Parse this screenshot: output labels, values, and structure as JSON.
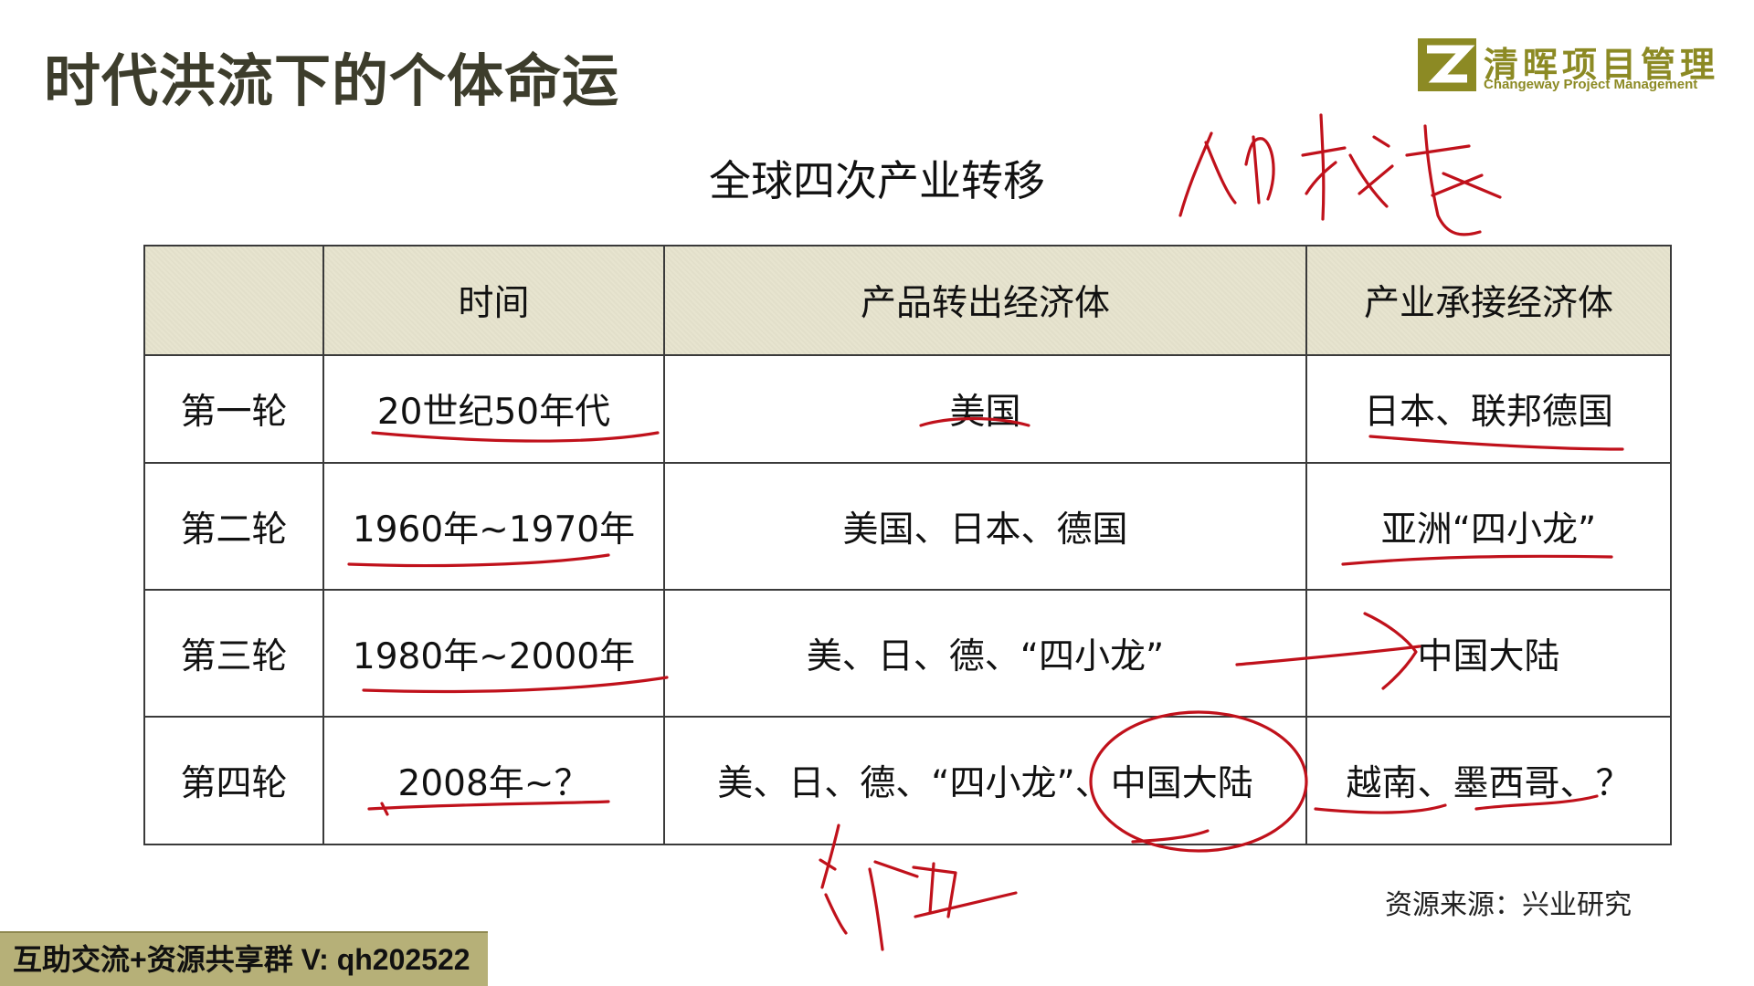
{
  "slide": {
    "title": "时代洪流下的个体命运"
  },
  "logo": {
    "name_cn": "清晖项目管理",
    "name_en": "Changeway Project Management"
  },
  "table": {
    "title": "全球四次产业转移",
    "headers": [
      "",
      "时间",
      "产品转出经济体",
      "产业承接经济体"
    ],
    "rows": [
      [
        "第一轮",
        "20世纪50年代",
        "美国",
        "日本、联邦德国"
      ],
      [
        "第二轮",
        "1960年~1970年",
        "美国、日本、德国",
        "亚洲“四小龙”"
      ],
      [
        "第三轮",
        "1980年~2000年",
        "美、日、德、“四小龙”",
        "中国大陆"
      ],
      [
        "第四轮",
        "2008年~？",
        "美、日、德、“四小龙”、中国大陆",
        "越南、墨西哥、？"
      ]
    ]
  },
  "source": "资源来源：兴业研究",
  "footer": {
    "text": "互助交流+资源共享群 V: qh202522"
  },
  "colors": {
    "header_fill": "#e7e4cf",
    "ink": "#c0111b",
    "logo": "#8c8a24",
    "banner": "#b6b078"
  },
  "icons": [
    "logo-mark-icon"
  ]
}
